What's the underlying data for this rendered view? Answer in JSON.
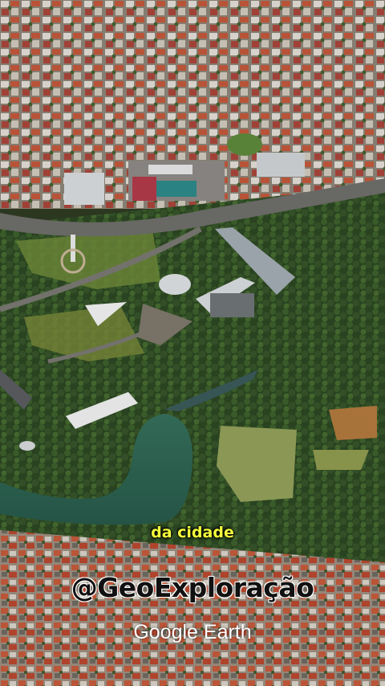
{
  "overlay": {
    "caption": "da cidade",
    "handle": "@GeoExploração",
    "attribution": "Google Earth"
  },
  "colors": {
    "caption": "#f4ff3c",
    "lake": "#2f6a55",
    "park": "#2e4a22",
    "city": "#a08f80"
  }
}
